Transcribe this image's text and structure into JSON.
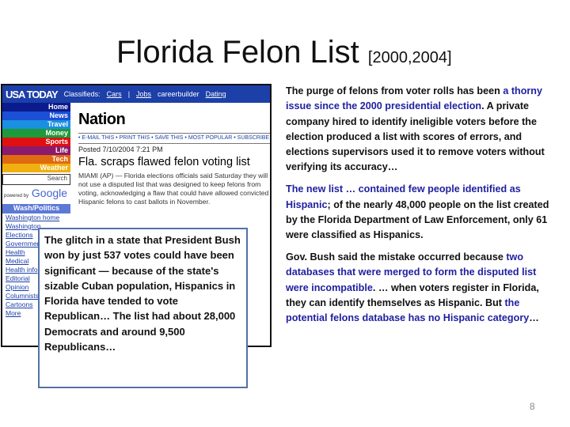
{
  "slide": {
    "title": "Florida Felon List",
    "title_sub": "[2000,2004]",
    "page_number": "8"
  },
  "screenshot": {
    "logo": "USA TODAY",
    "classifieds_label": "Classifieds:",
    "top_links": [
      "Cars",
      "|",
      "Jobs",
      "careerbuilder",
      "Dating"
    ],
    "nav": [
      {
        "label": "Home",
        "color": "#0b1a8c"
      },
      {
        "label": "News",
        "color": "#1a4fd6"
      },
      {
        "label": "Travel",
        "color": "#1b8fe0"
      },
      {
        "label": "Money",
        "color": "#1d9a3a"
      },
      {
        "label": "Sports",
        "color": "#e01010"
      },
      {
        "label": "Life",
        "color": "#8b1a6c"
      },
      {
        "label": "Tech",
        "color": "#e06a10"
      },
      {
        "label": "Weather",
        "color": "#f0b010"
      }
    ],
    "search_label": "Search",
    "google_label": "Google",
    "powered_by": "powered by",
    "section_header": "Wash/Politics",
    "section_items": [
      "Washington home",
      "Washington",
      "Elections",
      "Government",
      "Health",
      "Medical",
      "Health info",
      "Editorial",
      "Opinion",
      "Columnists",
      "Cartoons",
      "More"
    ],
    "section_title": "Nation",
    "nav_links": "• E-MAIL THIS • PRINT THIS • SAVE THIS • MOST POPULAR • SUBSCRIBE",
    "posted": "Posted 7/10/2004 7:21 PM",
    "headline": "Fla. scraps flawed felon voting list",
    "body": "MIAMI (AP) — Florida elections officials said Saturday they will not use a disputed list that was designed to keep felons from voting, acknowledging a flaw that could have allowed convicted Hispanic felons to cast ballots in November."
  },
  "callout": "The glitch in a state that President Bush won by just 537 votes could have been significant — because of the state's sizable Cuban population, Hispanics in Florida have tended to vote Republican… The list had about 28,000 Democrats and around 9,500 Republicans…",
  "right": {
    "p1": [
      "The purge of felons from voter rolls has been ",
      "a thorny issue since the 2000 presidential election",
      ". A private company hired to identify ineligible voters before the election produced a list with scores of errors, and elections supervisors used it to remove voters without verifying its accuracy…"
    ],
    "p2": [
      "The new list … contained few people identified as Hispanic",
      "; of the nearly 48,000 people on the list created by the Florida Department of Law Enforcement, only 61 were classified as Hispanics."
    ],
    "p3": [
      "Gov. Bush said the mistake occurred because ",
      "two databases that were merged to form the disputed list were incompatible",
      ". … when voters register in Florida, they can identify themselves as Hispanic. But ",
      "the potential felons database has no Hispanic category",
      "…"
    ]
  },
  "colors": {
    "highlight": "#1f1fa0",
    "callout_border": "#5471a6",
    "usatoday_blue": "#1c3fa8"
  }
}
